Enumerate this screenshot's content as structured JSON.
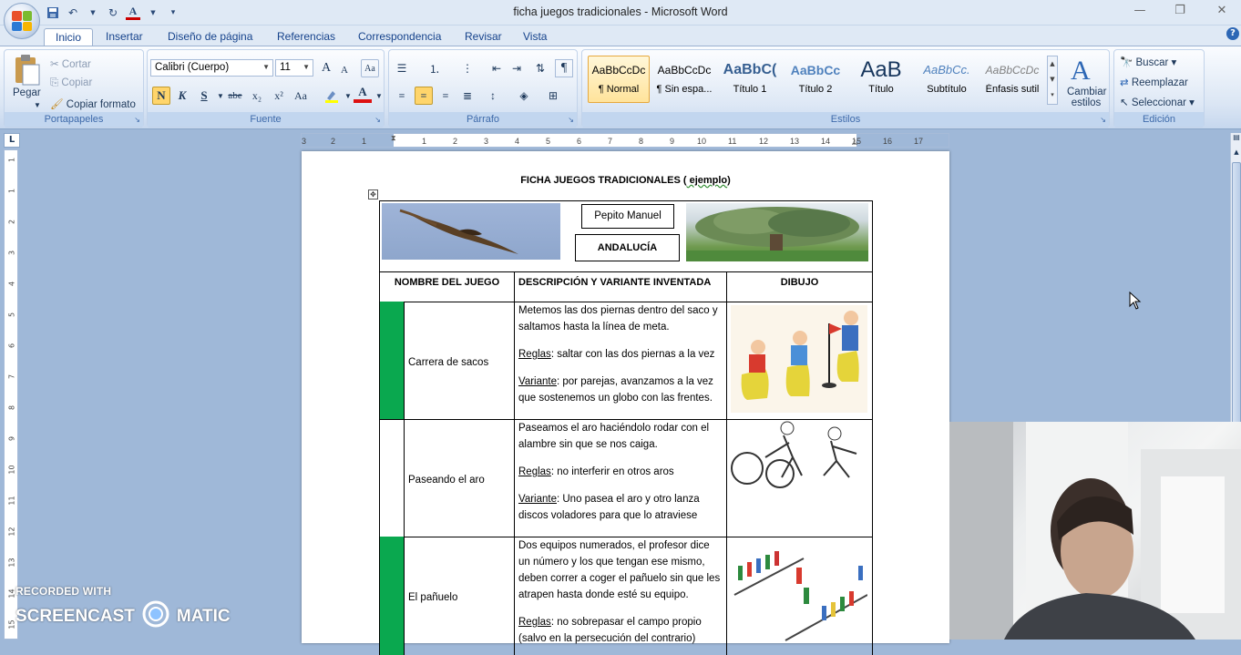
{
  "window": {
    "title": "ficha juegos tradicionales - Microsoft Word"
  },
  "qat": {
    "save": "save-icon",
    "undo": "undo-icon",
    "redo": "redo-icon",
    "font_color": "A"
  },
  "tabs": [
    {
      "label": "Inicio"
    },
    {
      "label": "Insertar"
    },
    {
      "label": "Diseño de página"
    },
    {
      "label": "Referencias"
    },
    {
      "label": "Correspondencia"
    },
    {
      "label": "Revisar"
    },
    {
      "label": "Vista"
    }
  ],
  "ribbon": {
    "clipboard": {
      "paste": "Pegar",
      "cut": "Cortar",
      "copy": "Copiar",
      "format_painter": "Copiar formato",
      "label": "Portapapeles"
    },
    "font": {
      "name": "Calibri (Cuerpo)",
      "size": "11",
      "bold": "N",
      "italic": "K",
      "underline": "S",
      "strike": "abe",
      "sub": "x₂",
      "sup": "x²",
      "case": "Aa",
      "color": "A",
      "grow": "A",
      "shrink": "A",
      "label": "Fuente"
    },
    "paragraph": {
      "label": "Párrafo",
      "pilcrow": "¶"
    },
    "styles": {
      "label": "Estilos",
      "items": [
        {
          "sample": "AaBbCcDc",
          "name": "¶ Normal"
        },
        {
          "sample": "AaBbCcDc",
          "name": "¶ Sin espa..."
        },
        {
          "sample": "AaBbC(",
          "name": "Título 1"
        },
        {
          "sample": "AaBbCc",
          "name": "Título 2"
        },
        {
          "sample": "AaB",
          "name": "Título"
        },
        {
          "sample": "AaBbCc.",
          "name": "Subtítulo"
        },
        {
          "sample": "AaBbCcDc",
          "name": "Énfasis sutil"
        }
      ],
      "change": "Cambiar estilos"
    },
    "editing": {
      "find": "Buscar",
      "replace": "Reemplazar",
      "select": "Seleccionar",
      "label": "Edición"
    }
  },
  "ruler": {
    "h_ticks": [
      "3",
      "2",
      "1",
      "1",
      "2",
      "3",
      "4",
      "5",
      "6",
      "7",
      "8",
      "9",
      "10",
      "11",
      "12",
      "13",
      "14",
      "15",
      "16",
      "17"
    ],
    "v_ticks": [
      "1",
      "1",
      "2",
      "3",
      "4",
      "5",
      "6",
      "7",
      "8",
      "9",
      "10",
      "11",
      "12",
      "13",
      "14",
      "15",
      "16"
    ],
    "corner": "L"
  },
  "document": {
    "title_a": "FICHA JUEGOS TRADICIONALES (",
    "title_b": " ejemplo",
    "title_c": ")",
    "name_box": "Pepito Manuel",
    "region_box": "ANDALUCÍA",
    "headers": [
      "NOMBRE  DEL JUEGO",
      "DESCRIPCIÓN Y VARIANTE INVENTADA",
      "DIBUJO"
    ],
    "rows": [
      {
        "name": "Carrera de sacos",
        "desc": "Metemos las  dos piernas dentro del saco y saltamos  hasta  la línea de meta.",
        "rule_label": "Reglas",
        "rule": ": saltar  con las dos piernas a la vez",
        "variant_label": "Variante",
        "variant": ": por parejas, avanzamos a la vez que sostenemos un globo con las frentes."
      },
      {
        "name": "Paseando el aro",
        "desc": "Paseamos el aro haciéndolo rodar con el alambre sin que se nos caiga.",
        "rule_label": "Reglas",
        "rule": ": no interferir en otros aros",
        "variant_label": "Variante",
        "variant": ": Uno pasea el aro y otro lanza discos voladores para que lo atraviese"
      },
      {
        "name": "El pañuelo",
        "desc": "Dos equipos numerados, el profesor dice un número y los que tengan  ese mismo, deben correr a coger el pañuelo sin que les atrapen hasta donde esté su equipo.",
        "rule_label": "Reglas",
        "rule": ": no sobrepasar el campo  propio (salvo en la persecución del contrario)"
      }
    ]
  },
  "watermark": {
    "line1": "RECORDED WITH",
    "line2a": "SCREENCAST",
    "line2b": "MATIC"
  },
  "colors": {
    "green_band": "#0aa84f",
    "accent": "#15428b"
  }
}
